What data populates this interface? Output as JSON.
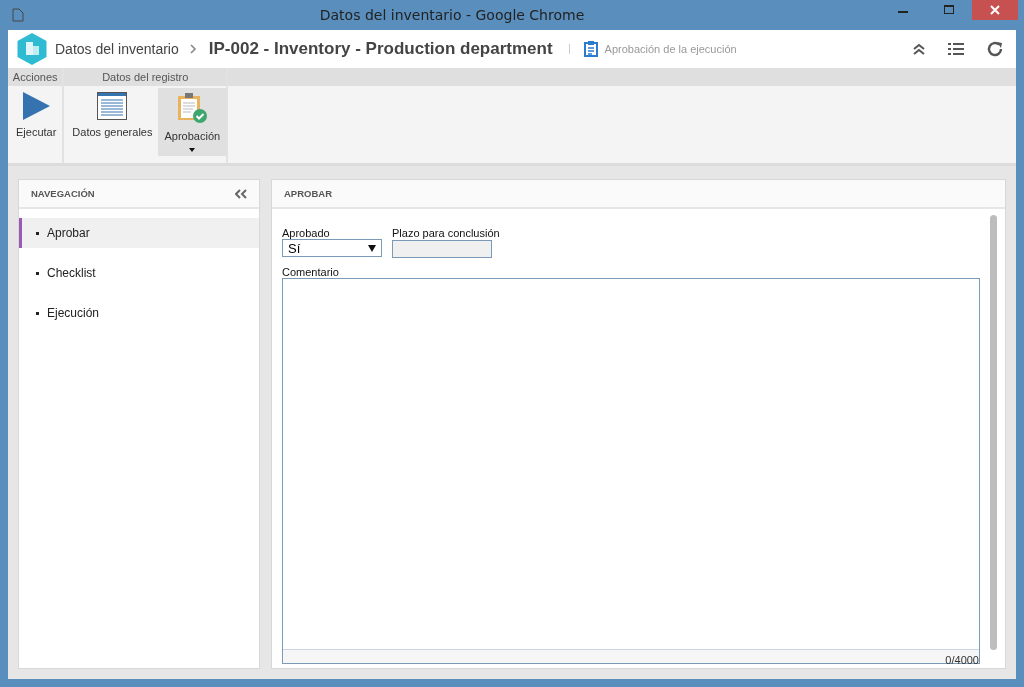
{
  "window": {
    "title": "Datos del inventario - Google Chrome"
  },
  "header": {
    "breadcrumb": "Datos del inventario",
    "title": "IP-002 - Inventory - Production department",
    "subtitle": "Aprobación de la ejecución"
  },
  "ribbon": [
    {
      "label": "Acciones",
      "items": [
        {
          "label": "Ejecutar",
          "kind": "play",
          "selected": false,
          "dropdown": false
        }
      ]
    },
    {
      "label": "Datos del registro",
      "items": [
        {
          "label": "Datos generales",
          "kind": "form",
          "selected": false,
          "dropdown": false
        },
        {
          "label": "Aprobación",
          "kind": "clipboard",
          "selected": true,
          "dropdown": true
        }
      ]
    }
  ],
  "navigation": {
    "title": "NAVEGACIÓN",
    "items": [
      {
        "label": "Aprobar",
        "selected": true
      },
      {
        "label": "Checklist",
        "selected": false
      },
      {
        "label": "Ejecución",
        "selected": false
      }
    ]
  },
  "panel": {
    "title": "APROBAR",
    "approved": {
      "label": "Aprobado",
      "value": "Sí"
    },
    "deadline": {
      "label": "Plazo para conclusión",
      "disabled": true
    },
    "comment": {
      "label": "Comentario",
      "counter": "0/4000"
    }
  }
}
